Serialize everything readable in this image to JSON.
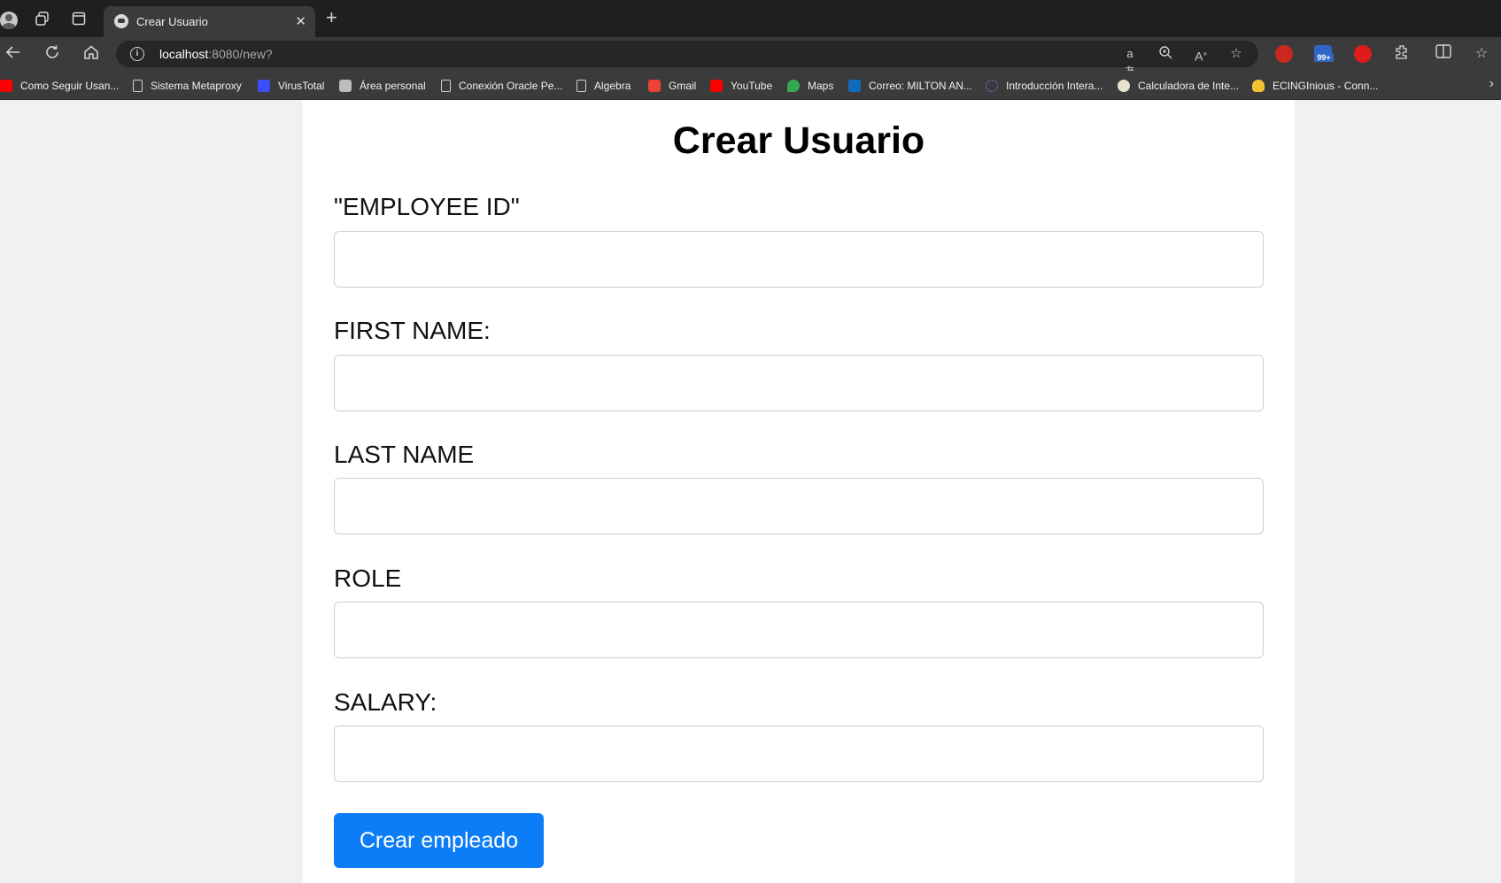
{
  "browser": {
    "tab_title": "Crear Usuario",
    "tab_close": "✕",
    "new_tab": "+",
    "url_host": "localhost",
    "url_rest": ":8080/new?",
    "extension_badge": "99+"
  },
  "bookmarks": [
    {
      "label": "Como Seguir Usan...",
      "icon": "youtube-icon",
      "color": "#ff0000"
    },
    {
      "label": "Sistema Metaproxy",
      "icon": "page-icon",
      "color": ""
    },
    {
      "label": "VirusTotal",
      "icon": "virustotal-icon",
      "color": "#394eff"
    },
    {
      "label": "Área personal",
      "icon": "moodle-icon",
      "color": "#bdbdbd"
    },
    {
      "label": "Conexión Oracle Pe...",
      "icon": "page-icon",
      "color": ""
    },
    {
      "label": "Algebra",
      "icon": "page-icon",
      "color": ""
    },
    {
      "label": "Gmail",
      "icon": "gmail-icon",
      "color": "#ea4335"
    },
    {
      "label": "YouTube",
      "icon": "youtube-icon",
      "color": "#ff0000"
    },
    {
      "label": "Maps",
      "icon": "maps-icon",
      "color": "#34a853"
    },
    {
      "label": "Correo: MILTON AN...",
      "icon": "outlook-icon",
      "color": "#0f6cbd"
    },
    {
      "label": "Introducción Intera...",
      "icon": "loading-icon",
      "color": "#6b8cff"
    },
    {
      "label": "Calculadora de Inte...",
      "icon": "calculator-icon",
      "color": "#e8e1cf"
    },
    {
      "label": "ECINGInious - Conn...",
      "icon": "bulb-icon",
      "color": "#f4c430"
    }
  ],
  "form": {
    "title": "Crear Usuario",
    "fields": [
      {
        "label": "\"EMPLOYEE ID\"",
        "value": ""
      },
      {
        "label": "FIRST NAME:",
        "value": ""
      },
      {
        "label": "LAST NAME",
        "value": ""
      },
      {
        "label": "ROLE",
        "value": ""
      },
      {
        "label": "SALARY:",
        "value": ""
      }
    ],
    "submit_label": "Crear empleado"
  },
  "colors": {
    "button": "#0d7cf7",
    "page_bg": "#f1f1f1",
    "card_bg": "#ffffff"
  }
}
